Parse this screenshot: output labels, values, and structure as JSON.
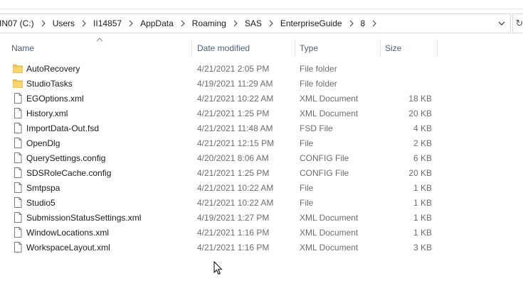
{
  "address_bar": {
    "crumbs": [
      "IN07 (C:)",
      "Users",
      "II14857",
      "AppData",
      "Roaming",
      "SAS",
      "EnterpriseGuide",
      "8"
    ]
  },
  "columns": {
    "name": "Name",
    "date_modified": "Date modified",
    "type": "Type",
    "size": "Size"
  },
  "sort": {
    "column": "name",
    "direction": "ascending"
  },
  "colors": {
    "folder": "#f5c543",
    "header_text": "#4c607a",
    "secondary_text": "#6d6d6d"
  },
  "files": [
    {
      "name": "AutoRecovery",
      "date": "4/21/2021 2:05 PM",
      "type": "File folder",
      "size": "",
      "icon": "folder-icon"
    },
    {
      "name": "StudioTasks",
      "date": "4/19/2021 11:29 AM",
      "type": "File folder",
      "size": "",
      "icon": "folder-icon"
    },
    {
      "name": "EGOptions.xml",
      "date": "4/21/2021 10:22 AM",
      "type": "XML Document",
      "size": "18 KB",
      "icon": "file-icon"
    },
    {
      "name": "History.xml",
      "date": "4/21/2021 1:25 PM",
      "type": "XML Document",
      "size": "20 KB",
      "icon": "file-icon"
    },
    {
      "name": "ImportData-Out.fsd",
      "date": "4/21/2021 11:48 AM",
      "type": "FSD File",
      "size": "4 KB",
      "icon": "file-icon"
    },
    {
      "name": "OpenDlg",
      "date": "4/21/2021 12:15 PM",
      "type": "File",
      "size": "2 KB",
      "icon": "file-icon"
    },
    {
      "name": "QuerySettings.config",
      "date": "4/20/2021 8:06 AM",
      "type": "CONFIG File",
      "size": "6 KB",
      "icon": "file-icon"
    },
    {
      "name": "SDSRoleCache.config",
      "date": "4/21/2021 1:25 PM",
      "type": "CONFIG File",
      "size": "20 KB",
      "icon": "file-icon"
    },
    {
      "name": "Smtpspa",
      "date": "4/21/2021 10:22 AM",
      "type": "File",
      "size": "1 KB",
      "icon": "file-icon"
    },
    {
      "name": "Studio5",
      "date": "4/21/2021 10:22 AM",
      "type": "File",
      "size": "1 KB",
      "icon": "file-icon"
    },
    {
      "name": "SubmissionStatusSettings.xml",
      "date": "4/19/2021 1:27 PM",
      "type": "XML Document",
      "size": "1 KB",
      "icon": "file-icon"
    },
    {
      "name": "WindowLocations.xml",
      "date": "4/21/2021 1:16 PM",
      "type": "XML Document",
      "size": "1 KB",
      "icon": "file-icon"
    },
    {
      "name": "WorkspaceLayout.xml",
      "date": "4/21/2021 1:16 PM",
      "type": "XML Document",
      "size": "3 KB",
      "icon": "file-icon"
    }
  ]
}
